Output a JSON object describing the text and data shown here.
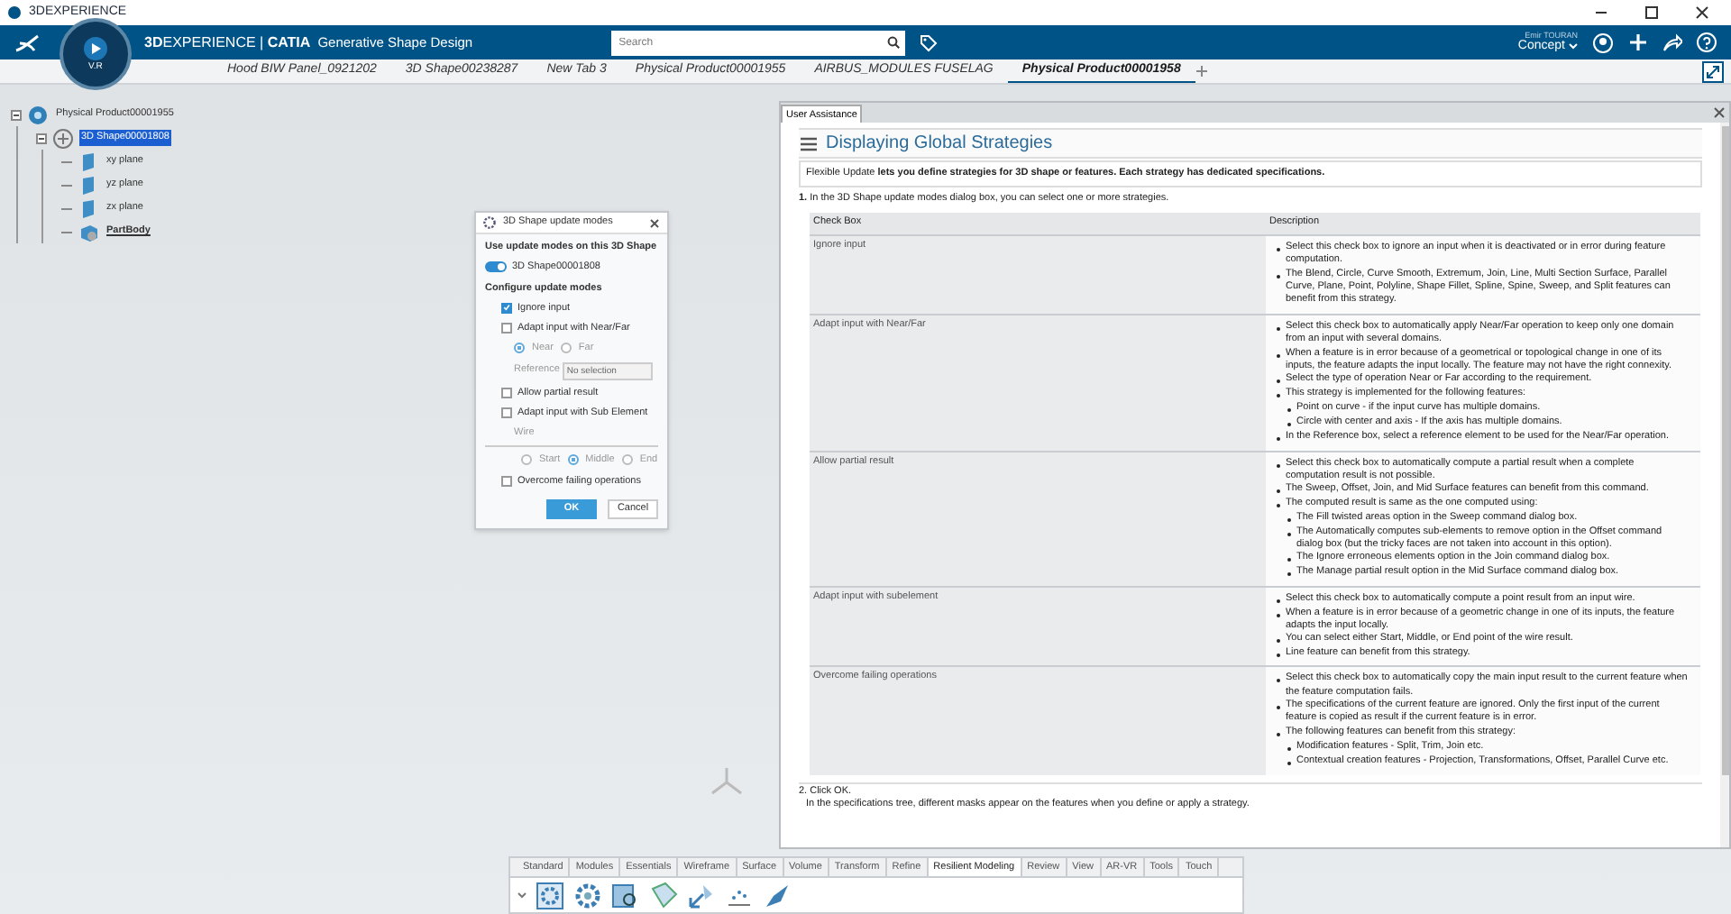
{
  "title_bar": {
    "title": "3DEXPERIENCE"
  },
  "header": {
    "compass_label": "V.R",
    "brand": "**3D**EXPERIENCE | **CATIA**",
    "app": "Generative Shape Design",
    "search": {
      "placeholder": "Search"
    },
    "user": "Emir TOURAN",
    "context": "Concept"
  },
  "tabs": [
    {
      "label": "Hood BIW Panel_0921202",
      "selected": false
    },
    {
      "label": "3D Shape00238287",
      "selected": false
    },
    {
      "label": "New Tab 3",
      "selected": false
    },
    {
      "label": "Physical Product00001955",
      "selected": false
    },
    {
      "label": "AIRBUS_MODULES FUSELAG",
      "selected": false
    },
    {
      "label": "Physical Product00001958",
      "selected": true
    }
  ],
  "tree": [
    {
      "label": "Physical Product00001955",
      "kind": "product",
      "selected": false,
      "children": [
        {
          "label": "3D Shape00001808",
          "kind": "shape",
          "selected": true,
          "children": [
            {
              "label": "xy plane",
              "kind": "plane",
              "selected": false
            },
            {
              "label": "yz plane",
              "kind": "plane",
              "selected": false
            },
            {
              "label": "zx plane",
              "kind": "plane",
              "selected": false
            },
            {
              "label": "PartBody",
              "kind": "body",
              "selected": false
            }
          ]
        }
      ]
    }
  ],
  "dialog": {
    "title": "3D Shape update modes",
    "heading": "Use update modes on this 3D Shape",
    "toggle": {
      "label": "3D Shape00001808",
      "on": true
    },
    "subheading": "Configure update modes",
    "options": [
      {
        "kind": "checkbox",
        "label": "Ignore input",
        "checked": true
      },
      {
        "kind": "checkbox",
        "label": "Adapt input with Near/Far",
        "checked": false
      },
      {
        "kind": "radios",
        "options": [
          {
            "label": "Near",
            "selected": true
          },
          {
            "label": "Far",
            "selected": false
          }
        ]
      },
      {
        "kind": "field",
        "label": "Reference",
        "placeholder": "No selection"
      },
      {
        "kind": "checkbox",
        "label": "Allow partial result",
        "checked": false
      },
      {
        "kind": "checkbox",
        "label": "Adapt input with Sub Element",
        "checked": false
      },
      {
        "kind": "text",
        "label": "Wire"
      },
      {
        "kind": "radios",
        "options": [
          {
            "label": "Start",
            "selected": false
          },
          {
            "label": "Middle",
            "selected": true
          },
          {
            "label": "End",
            "selected": false
          }
        ]
      },
      {
        "kind": "checkbox",
        "label": "Overcome failing operations",
        "checked": false
      }
    ],
    "buttons": [
      "OK",
      "Cancel"
    ]
  },
  "help": {
    "tab": "User Assistance",
    "title": "Displaying Global Strategies",
    "intro": "Flexible Update **lets you define strategies for 3D shape or features. Each strategy has dedicated specifications.**",
    "step1": "**1.** In the 3D Shape update modes dialog box, you can select one or more strategies.",
    "table": {
      "columns": [
        "Check Box",
        "Description"
      ],
      "rows": [
        {
          "label": "Ignore input",
          "bullets": [
            {
              "text": "Select this check box to ignore an input when it is deactivated or in error during feature computation."
            },
            {
              "text": "The Blend, Circle, Curve Smooth, Extremum, Join, Line, Multi Section Surface, Parallel Curve, Plane, Point, Polyline, Shape Fillet, Spline, Spine, Sweep, and Split features can benefit from this strategy."
            }
          ]
        },
        {
          "label": "Adapt input with Near/Far",
          "bullets": [
            {
              "text": "Select this check box to automatically apply Near/Far operation to keep only one domain from an input with several domains."
            },
            {
              "text": "When a feature is in error because of a geometrical or topological change in one of its inputs, the feature adapts the input locally. The feature may not have the right connexity."
            },
            {
              "text": "Select the type of operation Near or Far according to the requirement."
            },
            {
              "text": "This strategy is implemented for the following features:",
              "children": [
                {
                  "text": "Point on curve - if the input curve has multiple domains."
                },
                {
                  "text": "Circle with center and axis - If the axis has multiple domains."
                }
              ]
            },
            {
              "text": "In the Reference box, select a reference element to be used for the Near/Far operation."
            }
          ]
        },
        {
          "label": "Allow partial result",
          "bullets": [
            {
              "text": "Select this check box to automatically compute a partial result when a complete computation result is not possible."
            },
            {
              "text": "The Sweep, Offset, Join, and Mid Surface features can benefit from this command."
            },
            {
              "text": "The computed result is same as the one computed using:",
              "children": [
                {
                  "text": "The Fill twisted areas option in the Sweep command dialog box."
                },
                {
                  "text": "The Automatically computes sub-elements to remove option in the Offset command dialog box (but the tricky faces are not taken into account in this option)."
                },
                {
                  "text": "The Ignore erroneous elements option in the Join command dialog box."
                },
                {
                  "text": "The Manage partial result option in the Mid Surface command dialog box."
                }
              ]
            }
          ]
        },
        {
          "label": "Adapt input with subelement",
          "bullets": [
            {
              "text": "Select this check box to automatically compute a point result from an input wire."
            },
            {
              "text": "When a feature is in error because of a geometric change in one of its inputs, the feature adapts the input locally."
            },
            {
              "text": "You can select either Start, Middle, or End point of the wire result."
            },
            {
              "text": "Line feature can benefit from this strategy."
            }
          ]
        },
        {
          "label": "Overcome failing operations",
          "bullets": [
            {
              "text": "Select this check box to automatically copy the main input result to the current feature when the feature computation fails."
            },
            {
              "text": "The specifications of the current feature are ignored. Only the first input of the current feature is copied as result if the current feature is in error."
            },
            {
              "text": "The following features can benefit from this strategy:",
              "children": [
                {
                  "text": "Modification features - Split, Trim, Join etc."
                },
                {
                  "text": "Contextual creation features - Projection, Transformations, Offset, Parallel Curve etc."
                }
              ]
            }
          ]
        }
      ]
    },
    "step2": "2. Click OK.",
    "step2_note": "In the specifications tree, different masks appear on the features when you define or apply a strategy."
  },
  "action_bar": {
    "tabs": [
      {
        "label": "Standard",
        "selected": false
      },
      {
        "label": "Modules",
        "selected": false
      },
      {
        "label": "Essentials",
        "selected": false
      },
      {
        "label": "Wireframe",
        "selected": false
      },
      {
        "label": "Surface",
        "selected": false
      },
      {
        "label": "Volume",
        "selected": false
      },
      {
        "label": "Transform",
        "selected": false
      },
      {
        "label": "Refine",
        "selected": false
      },
      {
        "label": "Resilient Modeling",
        "selected": true
      },
      {
        "label": "Review",
        "selected": false
      },
      {
        "label": "View",
        "selected": false
      },
      {
        "label": "AR-VR",
        "selected": false
      },
      {
        "label": "Tools",
        "selected": false
      },
      {
        "label": "Touch",
        "selected": false
      }
    ]
  }
}
